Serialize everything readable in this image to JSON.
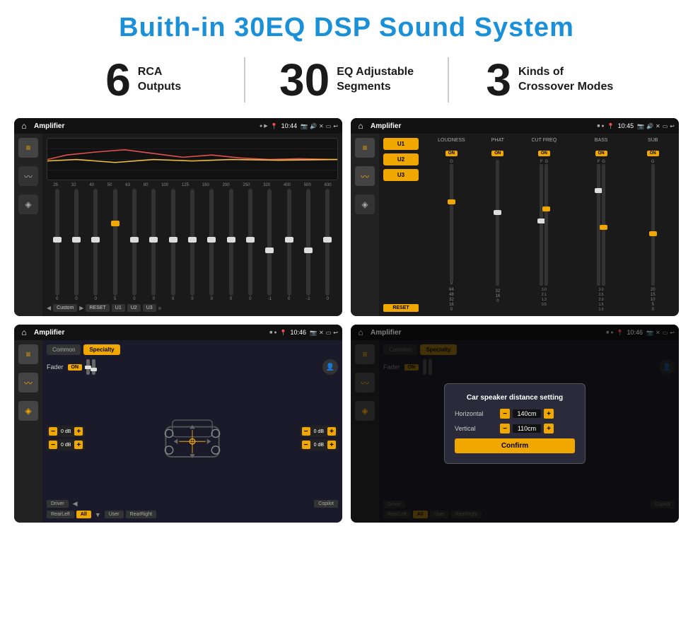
{
  "title": "Buith-in 30EQ DSP Sound System",
  "stats": [
    {
      "number": "6",
      "text_line1": "RCA",
      "text_line2": "Outputs"
    },
    {
      "number": "30",
      "text_line1": "EQ Adjustable",
      "text_line2": "Segments"
    },
    {
      "number": "3",
      "text_line1": "Kinds of",
      "text_line2": "Crossover Modes"
    }
  ],
  "screen1": {
    "title": "Amplifier",
    "time": "10:44",
    "eq_freqs": [
      "25",
      "32",
      "40",
      "50",
      "63",
      "80",
      "100",
      "125",
      "160",
      "200",
      "250",
      "320",
      "400",
      "500",
      "630"
    ],
    "eq_values": [
      "0",
      "0",
      "0",
      "5",
      "0",
      "0",
      "0",
      "0",
      "0",
      "0",
      "0",
      "-1",
      "0",
      "-1"
    ],
    "buttons": [
      "Custom",
      "RESET",
      "U1",
      "U2",
      "U3"
    ]
  },
  "screen2": {
    "title": "Amplifier",
    "time": "10:45",
    "presets": [
      "U1",
      "U2",
      "U3"
    ],
    "controls": [
      "LOUDNESS",
      "PHAT",
      "CUT FREQ",
      "BASS",
      "SUB"
    ],
    "toggles": [
      "ON",
      "ON",
      "ON",
      "ON",
      "ON"
    ],
    "reset": "RESET"
  },
  "screen3": {
    "title": "Amplifier",
    "time": "10:46",
    "tabs": [
      "Common",
      "Specialty"
    ],
    "fader_label": "Fader",
    "toggle": "ON",
    "db_values": [
      "0 dB",
      "0 dB",
      "0 dB",
      "0 dB"
    ],
    "buttons": [
      "Driver",
      "Copilot",
      "RearLeft",
      "All",
      "User",
      "RearRight"
    ]
  },
  "screen4": {
    "title": "Amplifier",
    "time": "10:46",
    "tabs": [
      "Common",
      "Specialty"
    ],
    "dialog": {
      "title": "Car speaker distance setting",
      "horizontal_label": "Horizontal",
      "horizontal_value": "140cm",
      "vertical_label": "Vertical",
      "vertical_value": "110cm",
      "confirm": "Confirm"
    },
    "buttons": [
      "Driver",
      "Copilot",
      "RearLeft",
      "All",
      "User",
      "RearRight"
    ]
  }
}
